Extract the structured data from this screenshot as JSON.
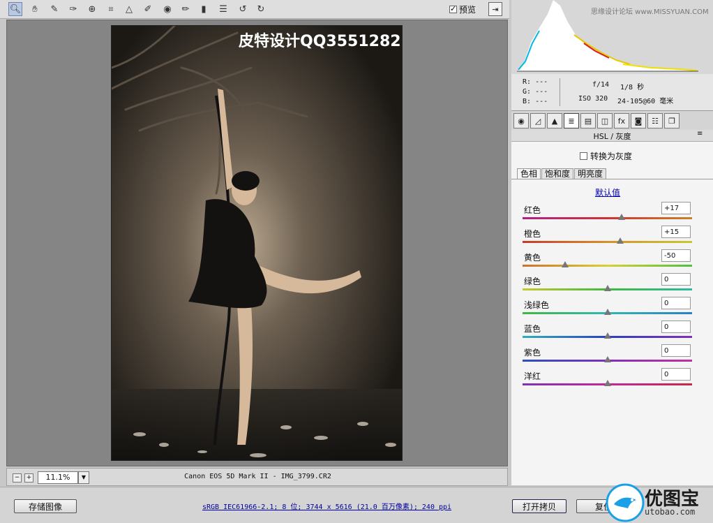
{
  "toolbar": {
    "tools": [
      "zoom-tool",
      "hand-tool",
      "white-balance-tool",
      "color-sampler-tool",
      "target-adjustment-tool",
      "crop-tool",
      "straighten-tool",
      "spot-removal-tool",
      "red-eye-tool",
      "adjustment-brush-tool",
      "graduated-filter-tool",
      "preferences-tool",
      "rotate-left-tool",
      "rotate-right-tool"
    ],
    "preview_label": "预览",
    "preview_checked": true
  },
  "image": {
    "watermark": "皮特设计QQ3551282"
  },
  "statusbar": {
    "zoom": "11.1%",
    "filename": "Canon EOS 5D Mark II -  IMG_3799.CR2"
  },
  "histogram": {
    "watermark": "思缘设计论坛 www.MISSYUAN.COM"
  },
  "info": {
    "r_label": "R:",
    "r_value": "---",
    "g_label": "G:",
    "g_value": "---",
    "b_label": "B:",
    "b_value": "---",
    "aperture": "f/14",
    "shutter": "1/8 秒",
    "iso": "ISO 320",
    "lens": "24-105@60 毫米"
  },
  "panel": {
    "title": "HSL / 灰度",
    "menu_icon": "≡",
    "gray_label": "转换为灰度",
    "subtabs": [
      "色相",
      "饱和度",
      "明亮度"
    ],
    "default_link": "默认值",
    "sliders": [
      {
        "label": "红色",
        "value": "+17",
        "level": 17,
        "track": "linear-gradient(90deg,#b0208a,#d23030,#c8822a)"
      },
      {
        "label": "橙色",
        "value": "+15",
        "level": 15,
        "track": "linear-gradient(90deg,#c83a2a,#d8902a,#c8c830)"
      },
      {
        "label": "黄色",
        "value": "-50",
        "level": -50,
        "track": "linear-gradient(90deg,#d0702a,#d8d030,#50c040)"
      },
      {
        "label": "绿色",
        "value": "0",
        "level": 0,
        "track": "linear-gradient(90deg,#c8c830,#40b840,#30b8a0)"
      },
      {
        "label": "浅绿色",
        "value": "0",
        "level": 0,
        "track": "linear-gradient(90deg,#40b840,#30b8b0,#2a80c8)"
      },
      {
        "label": "蓝色",
        "value": "0",
        "level": 0,
        "track": "linear-gradient(90deg,#30b0b8,#2a40c0,#8030b8)"
      },
      {
        "label": "紫色",
        "value": "0",
        "level": 0,
        "track": "linear-gradient(90deg,#2a50c0,#8030b8,#c030a0)"
      },
      {
        "label": "洋红",
        "value": "0",
        "level": 0,
        "track": "linear-gradient(90deg,#8030b8,#c02898,#c82848)"
      }
    ]
  },
  "bottombar": {
    "save_label": "存储图像",
    "workflow": "sRGB IEC61966-2.1; 8 位; 3744 x 5616 (21.0 百万像素); 240 ppi",
    "open_copy_label": "打开拷贝",
    "reset_label": "复位",
    "logo_text": "优图宝",
    "logo_domain": "utobao.com"
  }
}
